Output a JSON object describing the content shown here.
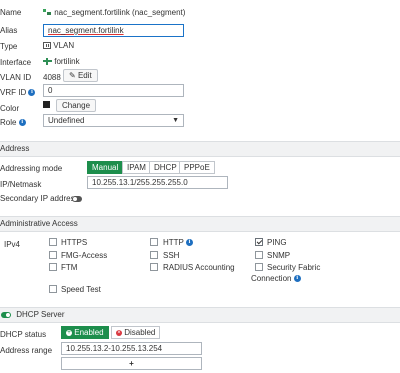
{
  "interface": {
    "name_label": "Name",
    "name_value": "nac_segment.fortilink (nac_segment)",
    "alias_label": "Alias",
    "alias_value": "nac_segment.fortilink",
    "type_label": "Type",
    "type_value": "VLAN",
    "iface_label": "Interface",
    "iface_value": "fortilink",
    "vlan_label": "VLAN ID",
    "vlan_value": "4088",
    "edit_label": "Edit",
    "vrf_label": "VRF ID",
    "vrf_value": "0",
    "color_label": "Color",
    "color_swatch": "#222222",
    "change_label": "Change",
    "role_label": "Role",
    "role_value": "Undefined"
  },
  "address": {
    "section_title": "Address",
    "mode_label": "Addressing mode",
    "modes": [
      "Manual",
      "IPAM",
      "DHCP",
      "PPPoE"
    ],
    "selected_mode": "Manual",
    "ipmask_label": "IP/Netmask",
    "ipmask_value": "10.255.13.1/255.255.255.0",
    "secondary_label": "Secondary IP address",
    "secondary_enabled": false
  },
  "admin": {
    "section_title": "Administrative Access",
    "ipv4_label": "IPv4",
    "options": {
      "https": "HTTPS",
      "http": "HTTP",
      "ping": "PING",
      "fmg": "FMG-Access",
      "ssh": "SSH",
      "snmp": "SNMP",
      "ftm": "FTM",
      "radius": "RADIUS Accounting",
      "security_fabric_1": "Security Fabric",
      "security_fabric_2": "Connection",
      "speed_test": "Speed Test"
    }
  },
  "dhcp": {
    "section_title": "DHCP Server",
    "status_label": "DHCP status",
    "enabled_label": "Enabled",
    "disabled_label": "Disabled",
    "range_label": "Address range",
    "range_value": "10.255.13.2-10.255.13.254",
    "add_symbol": "+"
  },
  "colors": {
    "accent_green": "#1d8e4c",
    "info_blue": "#1e6fc0",
    "disabled_red": "#d9363e"
  }
}
